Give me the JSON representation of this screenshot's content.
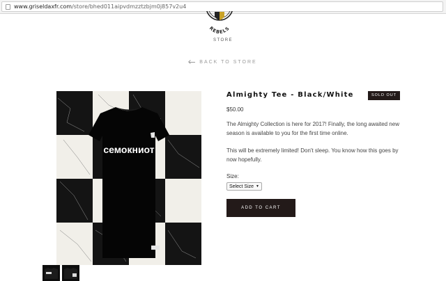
{
  "browser": {
    "url_host": "www.griseldaxfr.com",
    "url_path": "/store/bhed011aipvdmzztzbjm0j857v2u4"
  },
  "header": {
    "logo_text": "REBELS",
    "store_label": "STORE"
  },
  "nav": {
    "back_label": "BACK TO STORE"
  },
  "product": {
    "title": "Almighty Tee - Black/White",
    "badge": "SOLD OUT",
    "price": "$50.00",
    "description": [
      "The Almighty Collection is here for 2017! Finally, the long awaited new season is available to you for the first time online.",
      "This will be extremely limited! Don't sleep. You know how this goes by now hopefully."
    ],
    "shirt_print": "семокниот",
    "size_label": "Size:",
    "size_selected": "Select Size",
    "add_to_cart_label": "ADD TO CART"
  },
  "colors": {
    "dark_button": "#231a19",
    "background": "#ffffff"
  }
}
